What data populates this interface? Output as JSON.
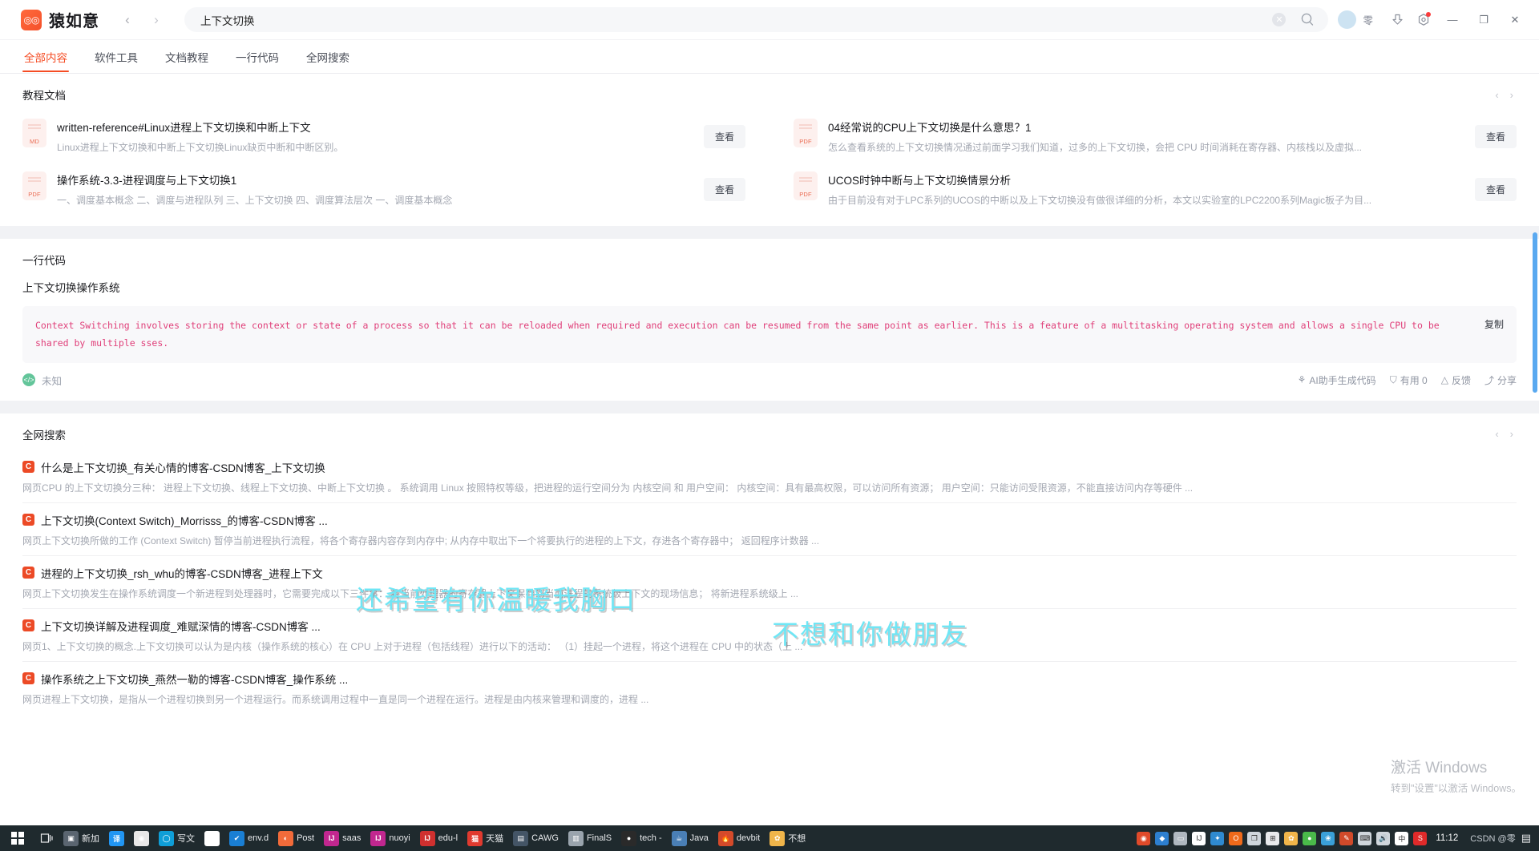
{
  "titlebar": {
    "app_name": "猿如意",
    "logo_glyph": "◎◎",
    "back_icon": "‹",
    "forward_icon": "›",
    "search_value": "上下文切换",
    "clear_icon": "✕",
    "search_icon": "search-icon",
    "username": "零",
    "download_icon": "download-icon",
    "settings_icon": "gear-icon",
    "minimize": "—",
    "maximize": "❐",
    "close": "✕"
  },
  "tabs": [
    {
      "label": "全部内容",
      "active": true
    },
    {
      "label": "软件工具",
      "active": false
    },
    {
      "label": "文档教程",
      "active": false
    },
    {
      "label": "一行代码",
      "active": false
    },
    {
      "label": "全网搜索",
      "active": false
    }
  ],
  "docs_section": {
    "title": "教程文档",
    "prev": "‹",
    "next": "›",
    "items": [
      {
        "filetype": "MD",
        "title": "written-reference#Linux进程上下文切换和中断上下文",
        "desc": "Linux进程上下文切换和中断上下文切换Linux缺页中断和中断区别。",
        "action": "查看"
      },
      {
        "filetype": "PDF",
        "title": "04经常说的CPU上下文切换是什么意思？1",
        "desc": "怎么查看系统的上下文切换情况通过前面学习我们知道，过多的上下文切换，会把 CPU 时间消耗在寄存器、内核栈以及虚拟...",
        "action": "查看"
      },
      {
        "filetype": "PDF",
        "title": "操作系统-3.3-进程调度与上下文切换1",
        "desc": "一、调度基本概念 二、调度与进程队列 三、上下文切换 四、调度算法层次 一、调度基本概念",
        "action": "查看"
      },
      {
        "filetype": "PDF",
        "title": "UCOS时钟中断与上下文切换情景分析",
        "desc": "由于目前没有对于LPC系列的UCOS的中断以及上下文切换没有做很详细的分析，本文以实验室的LPC2200系列Magic板子为目...",
        "action": "查看"
      }
    ]
  },
  "code_section": {
    "section_title": "一行代码",
    "snippet_title": "上下文切换操作系统",
    "code": "Context Switching involves storing the context or state of a process so that it can be reloaded when required and execution can be resumed from the same point as earlier. This is a feature of a multitasking operating system and allows a single CPU to be shared by multiple sses.",
    "copy_label": "复制",
    "language": "未知",
    "lang_icon": "code-icon",
    "actions": [
      {
        "icon": "ai-icon",
        "glyph": "⚘",
        "label": "AI助手生成代码"
      },
      {
        "icon": "thumbs-up-icon",
        "glyph": "⛉",
        "label": "有用 0"
      },
      {
        "icon": "warning-icon",
        "glyph": "△",
        "label": "反馈"
      },
      {
        "icon": "share-icon",
        "glyph": "⤴",
        "label": "分享"
      }
    ]
  },
  "web_section": {
    "title": "全网搜索",
    "prev": "‹",
    "next": "›",
    "badge": "C",
    "results": [
      {
        "title": "什么是上下文切换_有关心情的博客-CSDN博客_上下文切换",
        "desc": "网页CPU 的上下文切换分三种： 进程上下文切换、线程上下文切换、中断上下文切换 。 系统调用 Linux 按照特权等级，把进程的运行空间分为 内核空间 和 用户空间： 内核空间：具有最高权限，可以访问所有资源； 用户空间：只能访问受限资源，不能直接访问内存等硬件 ..."
      },
      {
        "title": "上下文切换(Context Switch)_Morrisss_的博客-CSDN博客 ...",
        "desc": "网页上下文切换所做的工作 (Context Switch) 暂停当前进程执行流程，将各个寄存器内容存到内存中; 从内存中取出下一个将要执行的进程的上下文，存进各个寄存器中； 返回程序计数器 ..."
      },
      {
        "title": "进程的上下文切换_rsh_whu的博客-CSDN博客_进程上下文",
        "desc": "网页上下文切换发生在操作系统调度一个新进程到处理器时，它需要完成以下三件事： 将当前处理器的寄存器上下文保存到当前进程的系统级上下文的现场信息； 将新进程系统级上 ..."
      },
      {
        "title": "上下文切换详解及进程调度_难赋深情的博客-CSDN博客 ...",
        "desc": "网页1、上下文切换的概念.上下文切换可以认为是内核（操作系统的核心）在 CPU 上对于进程（包括线程）进行以下的活动： （1）挂起一个进程，将这个进程在 CPU 中的状态（上 ..."
      },
      {
        "title": "操作系统之上下文切换_燕然一勒的博客-CSDN博客_操作系统 ...",
        "desc": "网页进程上下文切换，是指从一个进程切换到另一个进程运行。而系统调用过程中一直是同一个进程在运行。进程是由内核来管理和调度的，进程 ..."
      }
    ]
  },
  "watermarks": {
    "line1": "还希望有你温暖我胸口",
    "line2": "不想和你做朋友"
  },
  "windows_activation": {
    "title": "激活 Windows",
    "subtitle": "转到\"设置\"以激活 Windows。"
  },
  "taskbar": {
    "start_icon": "windows-start-icon",
    "task_view_icon": "task-view-icon",
    "items": [
      {
        "label": "新加",
        "glyph": "▣",
        "color": "#5a6570"
      },
      {
        "label": "",
        "glyph": "译",
        "color": "#2196f3"
      },
      {
        "label": "",
        "glyph": "◉",
        "color": "#e8e8e8"
      },
      {
        "label": "写文",
        "glyph": "◯",
        "color": "#0f9ed7"
      },
      {
        "label": "",
        "glyph": "T",
        "color": "#ffffff"
      },
      {
        "label": "env.d",
        "glyph": "✔",
        "color": "#1a7fd4"
      },
      {
        "label": "Post",
        "glyph": "◐",
        "color": "#f26b3a"
      },
      {
        "label": "saas",
        "glyph": "IJ",
        "color": "#c1278f"
      },
      {
        "label": "nuoyi",
        "glyph": "IJ",
        "color": "#c1278f"
      },
      {
        "label": "edu-l",
        "glyph": "IJ",
        "color": "#d0302f"
      },
      {
        "label": "天猫",
        "glyph": "猫",
        "color": "#e03a2f"
      },
      {
        "label": "CAWG",
        "glyph": "▤",
        "color": "#445566"
      },
      {
        "label": "FinalS",
        "glyph": "▥",
        "color": "#9aa4ad"
      },
      {
        "label": "tech -",
        "glyph": "●",
        "color": "#2a2a2a"
      },
      {
        "label": "Java",
        "glyph": "☕",
        "color": "#4a7fb5"
      },
      {
        "label": "devbit",
        "glyph": "🔥",
        "color": "#d44a2a"
      },
      {
        "label": "不想",
        "glyph": "✿",
        "color": "#f0b54a"
      }
    ],
    "tray": [
      {
        "glyph": "◉",
        "color": "#e04a2a"
      },
      {
        "glyph": "◆",
        "color": "#2d7fd0"
      },
      {
        "glyph": "▭",
        "color": "#b0b8c0"
      },
      {
        "glyph": "IJ",
        "color": "#ffffff"
      },
      {
        "glyph": "✦",
        "color": "#2f8ad0"
      },
      {
        "glyph": "O",
        "color": "#f06a1a"
      },
      {
        "glyph": "❐",
        "color": "#cfd6dc"
      },
      {
        "glyph": "⊞",
        "color": "#e8eaec"
      },
      {
        "glyph": "✿",
        "color": "#f0b54a"
      },
      {
        "glyph": "●",
        "color": "#4aba4a"
      },
      {
        "glyph": "❀",
        "color": "#3aa0d8"
      },
      {
        "glyph": "✎",
        "color": "#d04a2a"
      },
      {
        "glyph": "⌨",
        "color": "#cfd6dc"
      },
      {
        "glyph": "🔊",
        "color": "#cfd6dc"
      },
      {
        "glyph": "中",
        "color": "#ffffff"
      },
      {
        "glyph": "S",
        "color": "#e02a2a"
      }
    ],
    "clock_time": "11:12",
    "watermark_corner": "CSDN @零",
    "notification_icon": "notification-icon"
  }
}
